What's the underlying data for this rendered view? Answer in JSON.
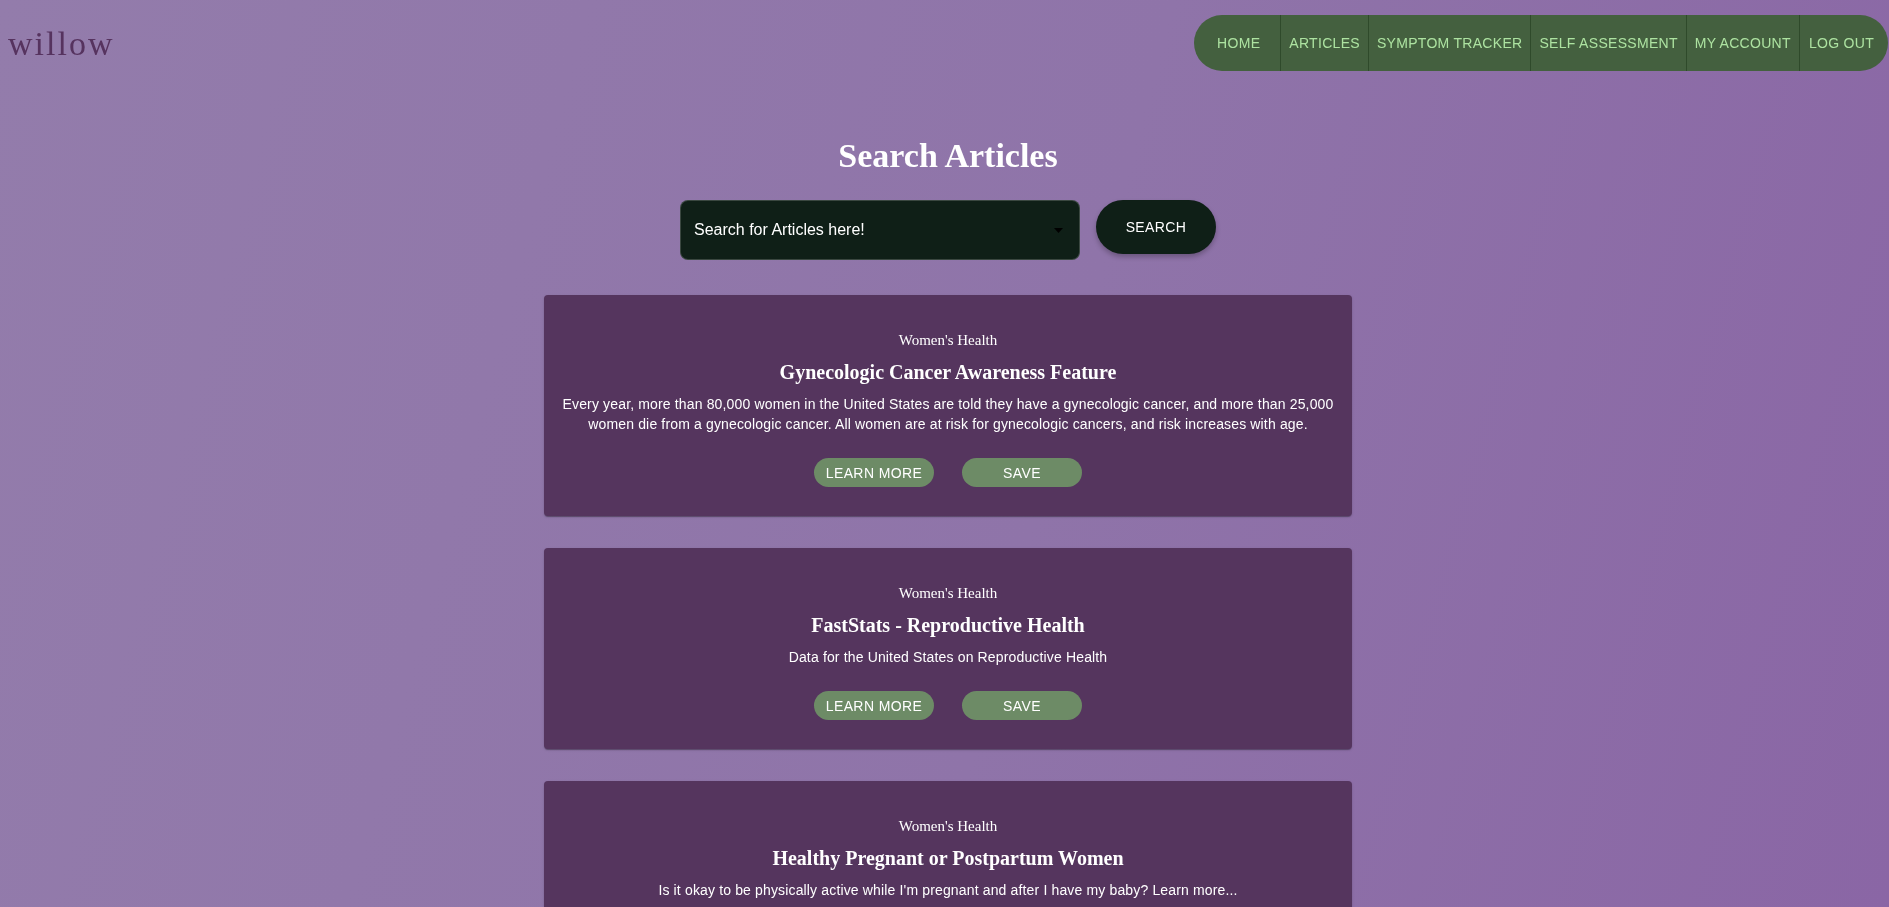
{
  "logo": "willow",
  "nav_items": [
    "HOME",
    "ARTICLES",
    "SYMPTOM TRACKER",
    "SELF ASSESSMENT",
    "MY ACCOUNT",
    "LOG OUT"
  ],
  "page_title": "Search Articles",
  "search": {
    "placeholder": "Search for Articles here!",
    "button": "SEARCH"
  },
  "articles": [
    {
      "category": "Women's Health",
      "title": "Gynecologic Cancer Awareness Feature",
      "description": "Every year, more than 80,000 women in the United States are told they have a gynecologic cancer, and more than 25,000 women die from a gynecologic cancer. All women are at risk for gynecologic cancers, and risk increases with age.",
      "actions": [
        "LEARN MORE",
        "SAVE"
      ]
    },
    {
      "category": "Women's Health",
      "title": "FastStats - Reproductive Health",
      "description": "Data for the United States on Reproductive Health",
      "actions": [
        "LEARN MORE",
        "SAVE"
      ]
    },
    {
      "category": "Women's Health",
      "title": "Healthy Pregnant or Postpartum Women",
      "description": "Is it okay to be physically active while I'm pregnant and after I have my baby? Learn more..."
    }
  ]
}
